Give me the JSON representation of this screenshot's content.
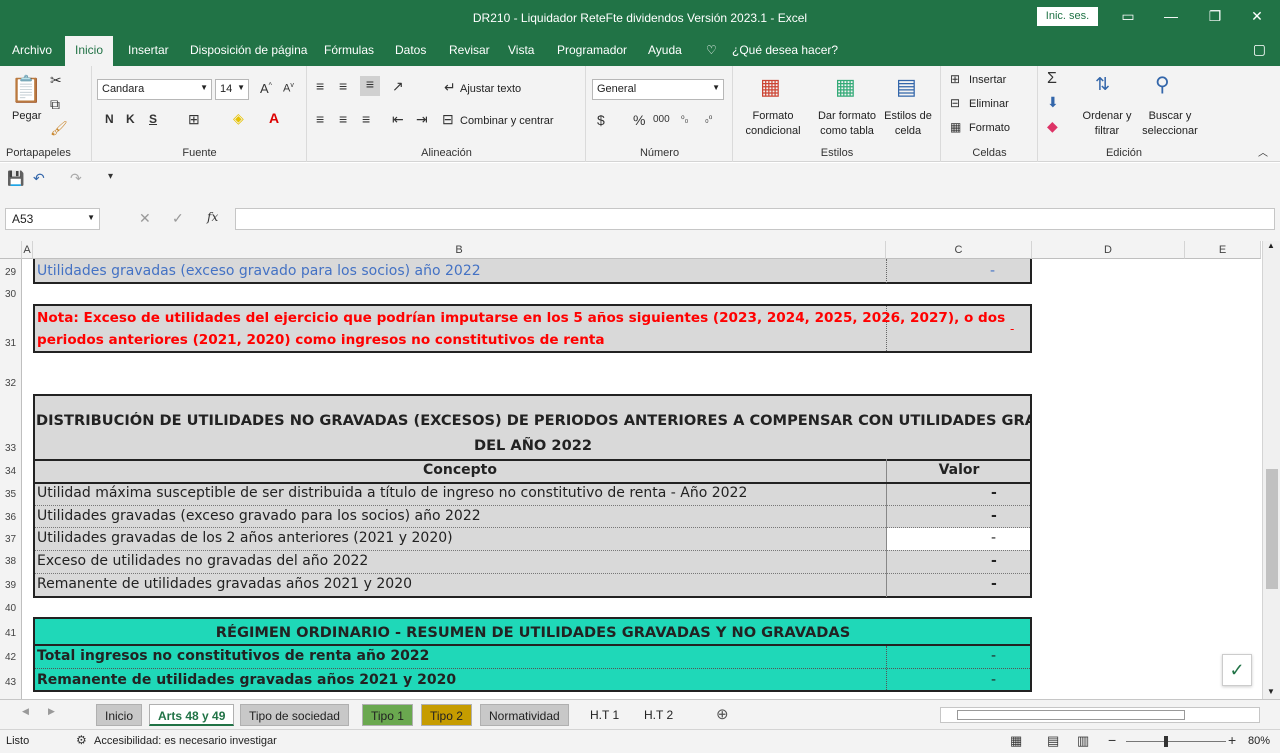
{
  "window": {
    "title": "DR210 - Liquidador ReteFte dividendos Versión 2023.1  -  Excel",
    "sign_in": "Inic. ses."
  },
  "tabs": [
    "Archivo",
    "Inicio",
    "Insertar",
    "Disposición de página",
    "Fórmulas",
    "Datos",
    "Revisar",
    "Vista",
    "Programador",
    "Ayuda"
  ],
  "tell_me": "¿Qué desea hacer?",
  "ribbon": {
    "clipboard": {
      "paste": "Pegar",
      "label": "Portapapeles"
    },
    "font": {
      "name": "Candara",
      "size": "14",
      "bold": "N",
      "italic": "K",
      "underline": "S",
      "label": "Fuente"
    },
    "alignment": {
      "wrap": "Ajustar texto",
      "merge": "Combinar y centrar",
      "label": "Alineación"
    },
    "number": {
      "format": "General",
      "label": "Número"
    },
    "styles": {
      "conditional": "Formato condicional",
      "as_table": "Dar formato como tabla",
      "cell_styles": "Estilos de celda",
      "label": "Estilos"
    },
    "cells": {
      "insert": "Insertar",
      "delete": "Eliminar",
      "format": "Formato",
      "label": "Celdas"
    },
    "editing": {
      "sort": "Ordenar y filtrar",
      "find": "Buscar y seleccionar",
      "label": "Edición"
    }
  },
  "name_box": "A53",
  "formula": "",
  "columns": [
    "A",
    "B",
    "C",
    "D",
    "E"
  ],
  "rows": {
    "r29": {
      "num": "29",
      "b": "Utilidades gravadas (exceso gravado para los socios) año 2022",
      "c": "-"
    },
    "r30": {
      "num": "30"
    },
    "r31": {
      "num": "31",
      "b1": "Nota: Exceso de utilidades del ejercicio que podrían imputarse en los 5 años siguientes (2023, 2024, 2025, 2026, 2027), o dos",
      "b2": "periodos anteriores (2021, 2020) como ingresos no constitutivos de renta",
      "c": "-"
    },
    "r32": {
      "num": "32"
    },
    "r33": {
      "num": "33",
      "title1": "DISTRIBUCIÓN DE UTILIDADES NO GRAVADAS (EXCESOS) DE PERIODOS ANTERIORES A COMPENSAR CON UTILIDADES GRAVADAS",
      "title2": "DEL AÑO 2022"
    },
    "r34": {
      "num": "34",
      "b": "Concepto",
      "c": "Valor"
    },
    "r35": {
      "num": "35",
      "b": "Utilidad máxima susceptible de ser distribuida a título de ingreso no constitutivo de renta - Año 2022",
      "c": "-"
    },
    "r36": {
      "num": "36",
      "b": "Utilidades gravadas (exceso gravado para los socios) año 2022",
      "c": "-"
    },
    "r37": {
      "num": "37",
      "b": "Utilidades gravadas de los 2 años anteriores (2021 y 2020)",
      "c": "-"
    },
    "r38": {
      "num": "38",
      "b": "Exceso de utilidades no gravadas del año 2022",
      "c": "-"
    },
    "r39": {
      "num": "39",
      "b": "Remanente de utilidades gravadas años 2021 y 2020",
      "c": "-"
    },
    "r40": {
      "num": "40"
    },
    "r41": {
      "num": "41",
      "b": "RÉGIMEN ORDINARIO - RESUMEN DE UTILIDADES GRAVADAS Y NO GRAVADAS"
    },
    "r42": {
      "num": "42",
      "b": "Total ingresos no constitutivos de renta año 2022",
      "c": "-"
    },
    "r43": {
      "num": "43",
      "b": "Remanente de utilidades gravadas años 2021 y 2020",
      "c": "-"
    }
  },
  "sheets": [
    "Inicio",
    "Arts 48 y 49",
    "Tipo de sociedad",
    "Tipo 1",
    "Tipo 2",
    "Normatividad",
    "H.T 1",
    "H.T 2"
  ],
  "status": {
    "ready": "Listo",
    "accessibility": "Accesibilidad: es necesario investigar",
    "zoom": "80%"
  },
  "colors": {
    "excel_green": "#217346",
    "teal": "#1fd8b8",
    "grey_cell": "#d9d9d9",
    "blue_text": "#4472c4",
    "red_text": "#ff0000"
  }
}
